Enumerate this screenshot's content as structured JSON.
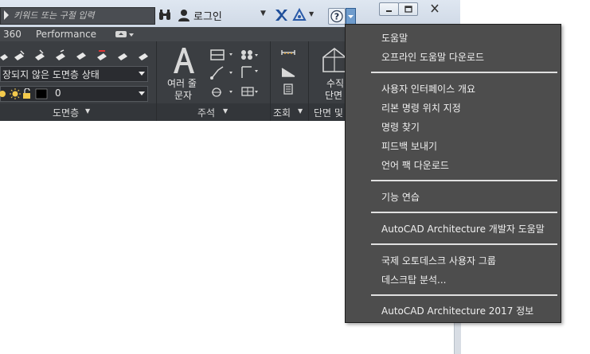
{
  "search": {
    "placeholder": "키워드 또는 구절 입력"
  },
  "account": {
    "login_label": "로그인"
  },
  "tabs": [
    {
      "label": "360"
    },
    {
      "label": "Performance"
    }
  ],
  "ribbon": {
    "layer_state_dropdown": "장되지 않은 도면층 상태",
    "layer_dropdown": "0",
    "layers_panel_title": "도면층",
    "multiline_text_label_line1": "여러 줄",
    "multiline_text_label_line2": "문자",
    "annotation_panel_title": "주석",
    "inquiry_panel_title": "조회",
    "section_label_line1": "수직",
    "section_label_line2": "단면",
    "section_panel_title": "단면 및"
  },
  "help_menu": {
    "items": [
      "도움말",
      "오프라인 도움말 다운로드",
      "사용자 인터페이스 개요",
      "리본 명령 위치 지정",
      "명령 찾기",
      "피드백 보내기",
      "언어 팩 다운로드",
      "기능 연습",
      "AutoCAD Architecture 개발자 도움말",
      "국제 오토데스크 사용자 그룹",
      "데스크탑 분석...",
      "AutoCAD Architecture 2017 정보"
    ]
  },
  "colors": {
    "menu_bg": "#4d4d4d",
    "ribbon_bg": "#3b3e42",
    "accent_blue": "#2f5d91"
  }
}
